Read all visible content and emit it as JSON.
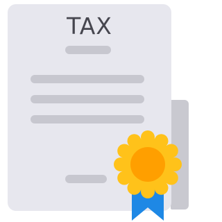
{
  "document": {
    "title": "TAX"
  },
  "icons": {
    "document": "tax-document-icon",
    "seal": "award-seal-icon",
    "ribbon": "award-ribbon-icon"
  },
  "colors": {
    "page": "#e7e7ee",
    "page_shadow": "#c9c9d0",
    "text_lines": "#c7c7cf",
    "title_text": "#46464f",
    "seal_outer": "#ffc21a",
    "seal_inner": "#ff9f00",
    "ribbon": "#1e88e5"
  }
}
